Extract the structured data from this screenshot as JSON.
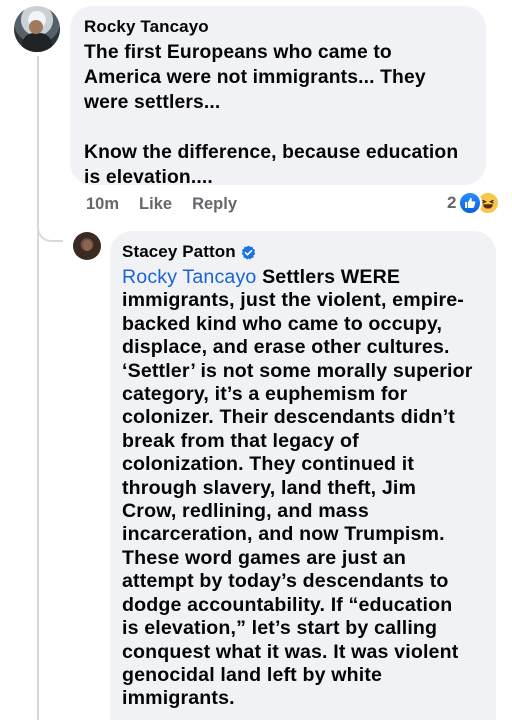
{
  "comment_1": {
    "author": "Rocky Tancayo",
    "text": "The first Europeans who came to\nAmerica were not immigrants... They\nwere settlers...\n\nKnow the difference, because education\nis elevation....",
    "time": "10m",
    "like_label": "Like",
    "reply_label": "Reply",
    "reaction_count": "2",
    "reactions": [
      "like-icon",
      "haha-icon"
    ]
  },
  "comment_2": {
    "author": "Stacey Patton",
    "verified": true,
    "mention": "Rocky Tancayo",
    "text": " Settlers WERE\nimmigrants, just the violent, empire-\nbacked kind who came to occupy,\ndisplace, and erase other cultures.\n‘Settler’ is not some morally superior\ncategory, it’s a euphemism for\ncolonizer. Their descendants didn’t\nbreak from that legacy of\ncolonization.  They continued it\nthrough slavery, land theft, Jim\nCrow, redlining, and mass\nincarceration, and now Trumpism.\nThese word games are just an\nattempt by today’s descendants to\ndodge accountability.  If “education\nis elevation,” let’s start by calling\nconquest what it was.  It was violent\ngenocidal land left by white\nimmigrants."
  },
  "colors": {
    "bubble": "#f0f2f5",
    "mention": "#1b63d4",
    "secondary_text": "#65676b",
    "like_blue": "#0a63d9",
    "haha_yellow": "#f7c64a"
  }
}
